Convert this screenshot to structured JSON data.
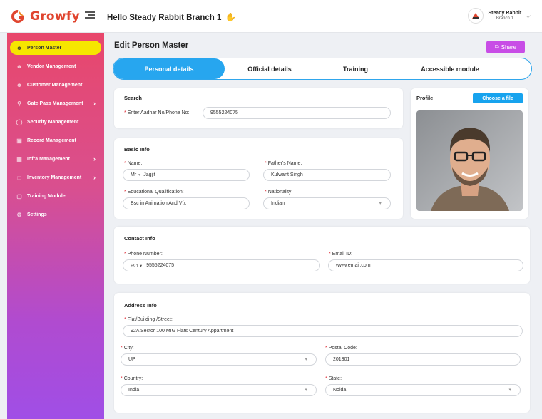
{
  "brand": {
    "name": "Growfy",
    "accent": "#e0452f"
  },
  "header": {
    "greeting": "Hello Steady Rabbit Branch 1",
    "user_name": "Steady Rabbit",
    "user_branch": "Branch 1"
  },
  "sidebar": {
    "items": [
      {
        "label": "Person Master",
        "icon": "person-icon",
        "active": true
      },
      {
        "label": "Vendor Management",
        "icon": "person-icon"
      },
      {
        "label": "Customer Management",
        "icon": "person-icon"
      },
      {
        "label": "Gate Pass Management",
        "icon": "key-icon",
        "chevron": true
      },
      {
        "label": "Security Management",
        "icon": "shield-icon"
      },
      {
        "label": "Record Management",
        "icon": "record-icon"
      },
      {
        "label": "Infra Management",
        "icon": "infra-icon",
        "chevron": true
      },
      {
        "label": "Inventory Management",
        "icon": "box-icon",
        "chevron": true
      },
      {
        "label": "Training Module",
        "icon": "training-icon"
      },
      {
        "label": "Settings",
        "icon": "gear-icon"
      }
    ]
  },
  "page": {
    "title": "Edit Person Master",
    "share_label": "Share"
  },
  "tabs": [
    {
      "label": "Personal details",
      "active": true
    },
    {
      "label": "Official details"
    },
    {
      "label": "Training"
    },
    {
      "label": "Accessible module"
    }
  ],
  "search": {
    "title": "Search",
    "label": "Enter Aadhar No/Phone No:",
    "value": "9555224075"
  },
  "profile": {
    "title": "Profile",
    "choose_label": "Choose a file"
  },
  "basic_info": {
    "title": "Basic Info",
    "name_label": "Name:",
    "salutation": "Mr",
    "name_value": "Jagjit",
    "father_label": "Father's Name:",
    "father_value": "Kulwant Singh",
    "education_label": "Educational Qualification:",
    "education_value": "Bsc in Animation And Vfx",
    "nationality_label": "Nationality:",
    "nationality_value": "Indian"
  },
  "contact_info": {
    "title": "Contact Info",
    "phone_label": "Phone Number:",
    "phone_prefix": "+91",
    "phone_value": "9555224075",
    "email_label": "Email ID:",
    "email_value": "www.email.com"
  },
  "address_info": {
    "title": "Address Info",
    "street_label": "Flat/Building /Street:",
    "street_value": "92A Sector 100 MIG Flats Century Appartment",
    "city_label": "City:",
    "city_value": "UP",
    "postal_label": "Postal Code:",
    "postal_value": "201301",
    "country_label": "Country:",
    "country_value": "India",
    "state_label": "State:",
    "state_value": "Noida"
  }
}
